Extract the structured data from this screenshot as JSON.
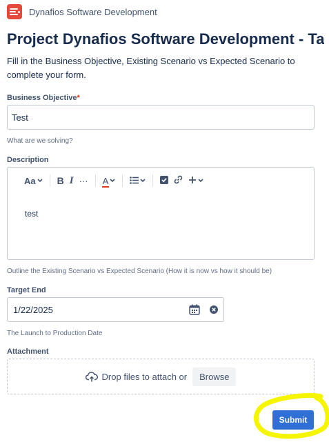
{
  "header": {
    "project_name": "Dynafios Software Development"
  },
  "title": "Project Dynafios Software Development - Ta...",
  "intro": "Fill in the Business Objective, Existing Scenario vs Expected Scenario to complete your form.",
  "business_objective": {
    "label": "Business Objective",
    "required_mark": "*",
    "value": "Test",
    "help": "What are we solving?"
  },
  "description": {
    "label": "Description",
    "toolbar": {
      "text_style": "Aa",
      "bold": "B",
      "italic": "I",
      "more": "···",
      "text_color": "A"
    },
    "content": "test",
    "help": "Outline the Existing Scenario vs Expected Scenario (How it is now vs how it should be)"
  },
  "target_end": {
    "label": "Target End",
    "value": "1/22/2025",
    "help": "The Launch to Production Date"
  },
  "attachment": {
    "label": "Attachment",
    "drop_text": "Drop files to attach or",
    "browse_label": "Browse"
  },
  "submit_label": "Submit",
  "colors": {
    "logo": "#e5493a",
    "submit": "#2f6fd6",
    "highlight": "#f5f500",
    "text_color_underline": "#de350b"
  }
}
